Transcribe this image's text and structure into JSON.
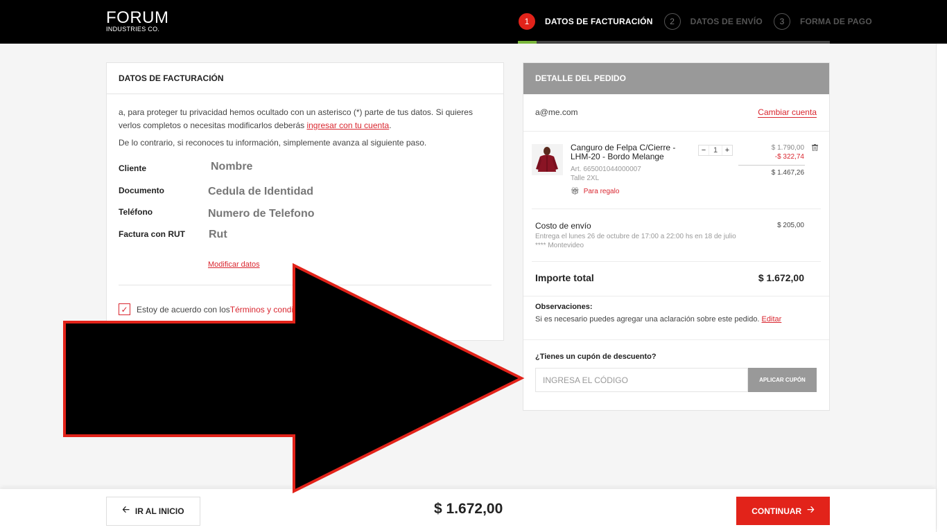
{
  "header": {
    "logo_main": "FORUM",
    "logo_sub": "INDUSTRIES CO.",
    "steps": [
      {
        "num": "1",
        "label": "DATOS DE FACTURACIÓN"
      },
      {
        "num": "2",
        "label": "DATOS DE ENVÍO"
      },
      {
        "num": "3",
        "label": "FORMA DE PAGO"
      }
    ]
  },
  "billing": {
    "title": "DATOS DE FACTURACIÓN",
    "intro_pre": "a, para proteger tu privacidad hemos ocultado con un asterisco (*) parte de tus datos. Si quieres verlos completos o necesitas modificarlos deberás ",
    "intro_link": "ingresar con tu cuenta",
    "intro_post": ".",
    "intro2": "De lo contrario, si reconoces tu información, simplemente avanza al siguiente paso.",
    "fields": [
      {
        "label": "Cliente",
        "value": "Nombre"
      },
      {
        "label": "Documento",
        "value": "Cedula de Identidad"
      },
      {
        "label": "Teléfono",
        "value": "Numero de Telefono"
      },
      {
        "label": "Factura con RUT",
        "value": "Rut"
      }
    ],
    "modify_link": "Modificar datos",
    "agree_text": "Estoy de acuerdo con los ",
    "agree_link": "Términos y condi"
  },
  "order": {
    "title": "DETALLE DEL PEDIDO",
    "email": "a@me.com",
    "change_account": "Cambiar cuenta",
    "product": {
      "name": "Canguro de Felpa C/Cierre - LHM-20 - Bordo Melange",
      "art": "Art. 665001044000007",
      "size": "Talle 2XL",
      "gift": "Para regalo",
      "qty": "1",
      "price_orig": "$ 1.790,00",
      "discount": "-$ 322,74",
      "price_final": "$ 1.467,26"
    },
    "shipping": {
      "label": "Costo de envío",
      "detail1": "Entrega el lunes 26 de octubre de 17:00 a 22:00 hs en 18 de julio",
      "detail2": "**** Montevideo",
      "price": "$ 205,00"
    },
    "total_label": "Importe total",
    "total_value": "$ 1.672,00",
    "obs_label": "Observaciones:",
    "obs_text": "Si es necesario puedes agregar una aclaración sobre este pedido. ",
    "obs_link": "Editar",
    "coupon_label": "¿Tienes un cupón de descuento?",
    "coupon_placeholder": "INGRESA EL CÓDIGO",
    "coupon_button": "APLICAR CUPÓN"
  },
  "footer": {
    "home_button": "IR AL INICIO",
    "total": "$ 1.672,00",
    "continue_button": "CONTINUAR"
  },
  "colors": {
    "accent": "#e2231a",
    "progress": "#79b63b",
    "topbar": "#000000",
    "order_header": "#999999"
  }
}
